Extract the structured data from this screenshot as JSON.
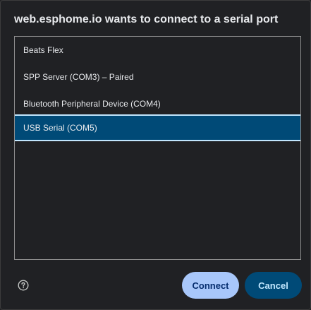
{
  "dialog": {
    "title": "web.esphome.io wants to connect to a serial port"
  },
  "ports": [
    {
      "label": "Beats Flex",
      "selected": false
    },
    {
      "label": "SPP Server (COM3) – Paired",
      "selected": false
    },
    {
      "label": "Bluetooth Peripheral Device (COM4)",
      "selected": false
    },
    {
      "label": "USB Serial (COM5)",
      "selected": true
    }
  ],
  "footer": {
    "help_icon": "help-circle-icon",
    "connect_label": "Connect",
    "cancel_label": "Cancel"
  },
  "colors": {
    "background": "#202124",
    "selected_row": "#004a77",
    "connect_button": "#a8c7fa",
    "cancel_button": "#004a77"
  }
}
